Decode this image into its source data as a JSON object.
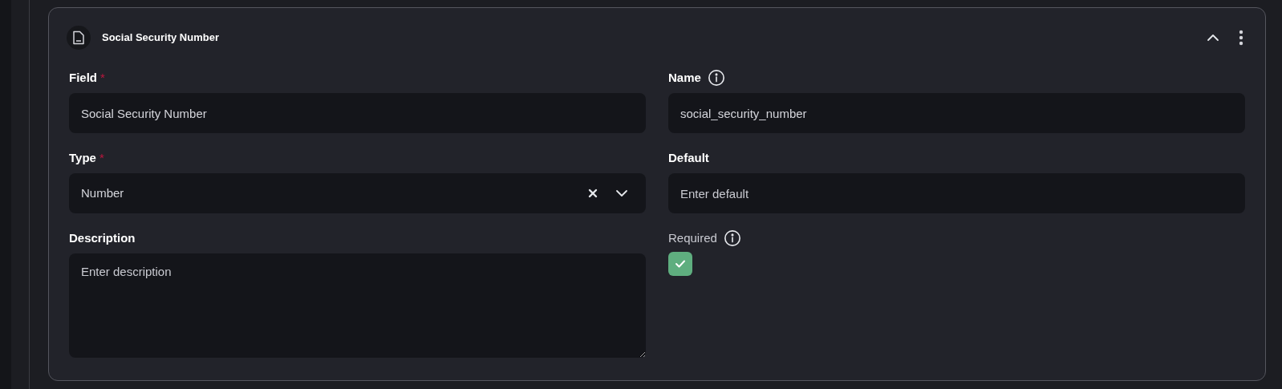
{
  "card": {
    "title": "Social Security Number",
    "expanded": true
  },
  "fields": [
    {
      "kind": "text",
      "label": "Field",
      "required_mark": "*",
      "info": false,
      "value": "Social Security Number"
    },
    {
      "kind": "text",
      "label": "Name",
      "info": true,
      "value": "social_security_number"
    },
    {
      "kind": "select",
      "label": "Type",
      "required_mark": "*",
      "info": false,
      "value": "Number"
    },
    {
      "kind": "text",
      "label": "Default",
      "info": false,
      "placeholder": "Enter default"
    },
    {
      "kind": "textarea",
      "label": "Description",
      "info": false,
      "placeholder": "Enter description"
    },
    {
      "kind": "checkbox",
      "label": "Required",
      "info": true,
      "checked": true
    }
  ]
}
